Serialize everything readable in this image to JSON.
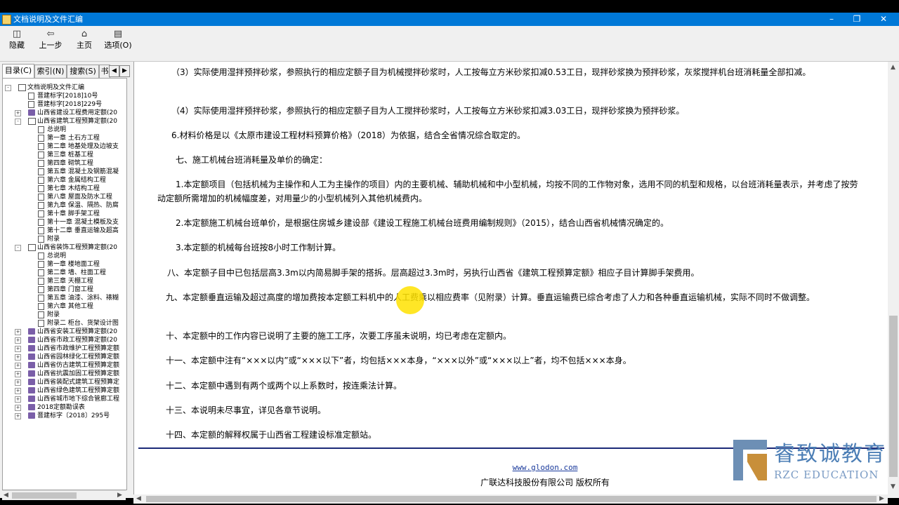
{
  "window": {
    "title": "文档说明及文件汇编"
  },
  "toolbar": {
    "hide": "隐藏",
    "back": "上一步",
    "home": "主页",
    "options": "选项(O)"
  },
  "tabs": {
    "contents": "目录(C)",
    "index": "索引(N)",
    "search": "搜索(S)",
    "more": "书"
  },
  "tree": [
    {
      "t": "文档说明及文件汇编",
      "lv": 0,
      "ic": "open",
      "exp": "-"
    },
    {
      "t": "晋建标字[2018]10号",
      "lv": 1,
      "ic": "page"
    },
    {
      "t": "晋建标字[2018]229号",
      "lv": 1,
      "ic": "page"
    },
    {
      "t": "山西省建设工程费用定额(20",
      "lv": 1,
      "ic": "book",
      "exp": "+"
    },
    {
      "t": "山西省建筑工程预算定额(20",
      "lv": 1,
      "ic": "open",
      "exp": "-"
    },
    {
      "t": "总说明",
      "lv": 2,
      "ic": "page"
    },
    {
      "t": "第一章 土石方工程",
      "lv": 2,
      "ic": "page"
    },
    {
      "t": "第二章 地基处理及边坡支",
      "lv": 2,
      "ic": "page"
    },
    {
      "t": "第三章 桩基工程",
      "lv": 2,
      "ic": "page"
    },
    {
      "t": "第四章 砌筑工程",
      "lv": 2,
      "ic": "page"
    },
    {
      "t": "第五章 混凝土及钢筋混凝",
      "lv": 2,
      "ic": "page"
    },
    {
      "t": "第六章 金属结构工程",
      "lv": 2,
      "ic": "page"
    },
    {
      "t": "第七章 木结构工程",
      "lv": 2,
      "ic": "page"
    },
    {
      "t": "第八章 屋面及防水工程",
      "lv": 2,
      "ic": "page"
    },
    {
      "t": "第九章 保温、隔热、防腐",
      "lv": 2,
      "ic": "page"
    },
    {
      "t": "第十章 脚手架工程",
      "lv": 2,
      "ic": "page"
    },
    {
      "t": "第十一章 混凝土模板及支",
      "lv": 2,
      "ic": "page"
    },
    {
      "t": "第十二章 垂直运输及超高",
      "lv": 2,
      "ic": "page"
    },
    {
      "t": "附录",
      "lv": 2,
      "ic": "page"
    },
    {
      "t": "山西省装饰工程预算定额(20",
      "lv": 1,
      "ic": "open",
      "exp": "-"
    },
    {
      "t": "总说明",
      "lv": 2,
      "ic": "page"
    },
    {
      "t": "第一章 楼地面工程",
      "lv": 2,
      "ic": "page"
    },
    {
      "t": "第二章 墙、柱面工程",
      "lv": 2,
      "ic": "page"
    },
    {
      "t": "第三章 天棚工程",
      "lv": 2,
      "ic": "page"
    },
    {
      "t": "第四章 门窗工程",
      "lv": 2,
      "ic": "page"
    },
    {
      "t": "第五章 油漆、涂料、裱糊",
      "lv": 2,
      "ic": "page"
    },
    {
      "t": "第六章 其他工程",
      "lv": 2,
      "ic": "page"
    },
    {
      "t": "附录",
      "lv": 2,
      "ic": "page"
    },
    {
      "t": "附录二 柜台、货架设计图",
      "lv": 2,
      "ic": "page"
    },
    {
      "t": "山西省安装工程预算定额(20",
      "lv": 1,
      "ic": "book",
      "exp": "+"
    },
    {
      "t": "山西省市政工程预算定额(20",
      "lv": 1,
      "ic": "book",
      "exp": "+"
    },
    {
      "t": "山西省市政维护工程预算定额",
      "lv": 1,
      "ic": "book",
      "exp": "+"
    },
    {
      "t": "山西省园林绿化工程预算定额",
      "lv": 1,
      "ic": "book",
      "exp": "+"
    },
    {
      "t": "山西省仿古建筑工程预算定额",
      "lv": 1,
      "ic": "book",
      "exp": "+"
    },
    {
      "t": "山西省抗震加固工程预算定额",
      "lv": 1,
      "ic": "book",
      "exp": "+"
    },
    {
      "t": "山西省装配式建筑工程预算定",
      "lv": 1,
      "ic": "book",
      "exp": "+"
    },
    {
      "t": "山西省绿色建筑工程预算定额",
      "lv": 1,
      "ic": "book",
      "exp": "+"
    },
    {
      "t": "山西省城市地下综合管廊工程",
      "lv": 1,
      "ic": "book",
      "exp": "+"
    },
    {
      "t": "2018定额勘误表",
      "lv": 1,
      "ic": "book",
      "exp": "+"
    },
    {
      "t": "晋建标字〔2018〕295号",
      "lv": 1,
      "ic": "book",
      "exp": "+"
    }
  ],
  "content": {
    "paragraphs": [
      "（3）实际使用湿拌预拌砂浆，参照执行的相应定额子目为机械搅拌砂浆时，人工按每立方米砂浆扣减0.53工日，现拌砂浆换为预拌砂浆，灰浆搅拌机台班消耗量全部扣减。",
      "（4）实际使用湿拌预拌砂浆，参照执行的相应定额子目为人工搅拌砂浆时，人工按每立方米砂浆扣减3.03工日，现拌砂浆换为预拌砂浆。",
      "6.材料价格是以《太原市建设工程材料预算价格》（2018）为依据，结合全省情况综合取定的。",
      "七、施工机械台班消耗量及单价的确定：",
      "1.本定额项目（包括机械为主操作和人工为主操作的项目）内的主要机械、辅助机械和中小型机械，均按不同的工作物对象，选用不同的机型和规格，以台班消耗量表示，并考虑了按劳动定额所需增加的机械幅度差，对用量少的小型机械列入其他机械费内。",
      "2.本定额施工机械台班单价，是根据住房城乡建设部《建设工程施工机械台班费用编制规则》（2015），结合山西省机械情况确定的。",
      "3.本定额的机械每台班按8小时工作制计算。",
      "八、本定额子目中已包括层高3.3m以内简易脚手架的搭拆。层高超过3.3m时，另执行山西省《建筑工程预算定额》相应子目计算脚手架费用。",
      "九、本定额垂直运输及超过高度的增加费按本定额工料机中的人工费乘以相应费率（见附录）计算。垂直运输费已综合考虑了人力和各种垂直运输机械，实际不同时不做调整。",
      "十、本定额中的工作内容已说明了主要的施工工序，次要工序虽未说明，均已考虑在定额内。",
      "十一、本定额中注有“×××以内”或“×××以下”者，均包括×××本身，“×××以外”或“×××以上”者，均不包括×××本身。",
      "十二、本定额中遇到有两个或两个以上系数时，按连乘法计算。",
      "十三、本说明未尽事宜，详见各章节说明。",
      "十四、本定额的解释权属于山西省工程建设标准定额站。"
    ],
    "footer_link": "www.glodon.com",
    "footer_copyright": "广联达科技股份有限公司 版权所有"
  },
  "watermark": {
    "cn": "睿致诚教育",
    "en": "RZC EDUCATION"
  },
  "colors": {
    "titlebar": "#0078d7",
    "rule": "#1c2a78",
    "link": "#1a3a9c",
    "cursor": "#ffe200"
  }
}
